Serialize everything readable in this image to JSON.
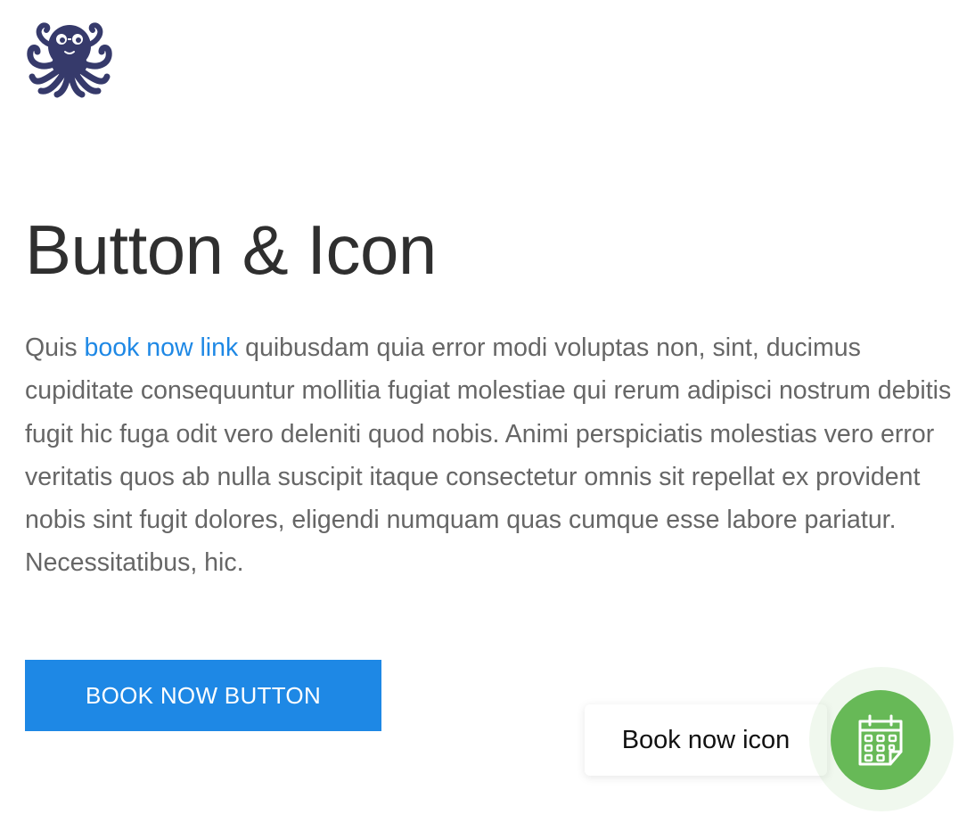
{
  "page": {
    "title": "Button & Icon",
    "paragraph_before_link": "Quis ",
    "link_text": "book now link",
    "paragraph_after_link": " quibusdam quia error modi voluptas non, sint, ducimus cupiditate consequuntur mollitia fugiat molestiae qui rerum adipisci nostrum debitis fugit hic fuga odit vero deleniti quod nobis. Animi perspiciatis molestias vero error veritatis quos ab nulla suscipit itaque consectetur omnis sit repellat ex provident nobis sint fugit dolores, eligendi numquam quas cumque esse labore pariatur. Necessitatibus, hic."
  },
  "book_button": {
    "label": "BOOK NOW BUTTON"
  },
  "book_icon": {
    "label": "Book now icon",
    "icon": "calendar-icon"
  },
  "logo": {
    "icon": "octopus-logo-icon"
  },
  "colors": {
    "link": "#1e88e5",
    "button": "#1e88e5",
    "fab": "#67b957",
    "logo": "#363a6b",
    "title": "#2f2f2f",
    "text": "#666666"
  }
}
